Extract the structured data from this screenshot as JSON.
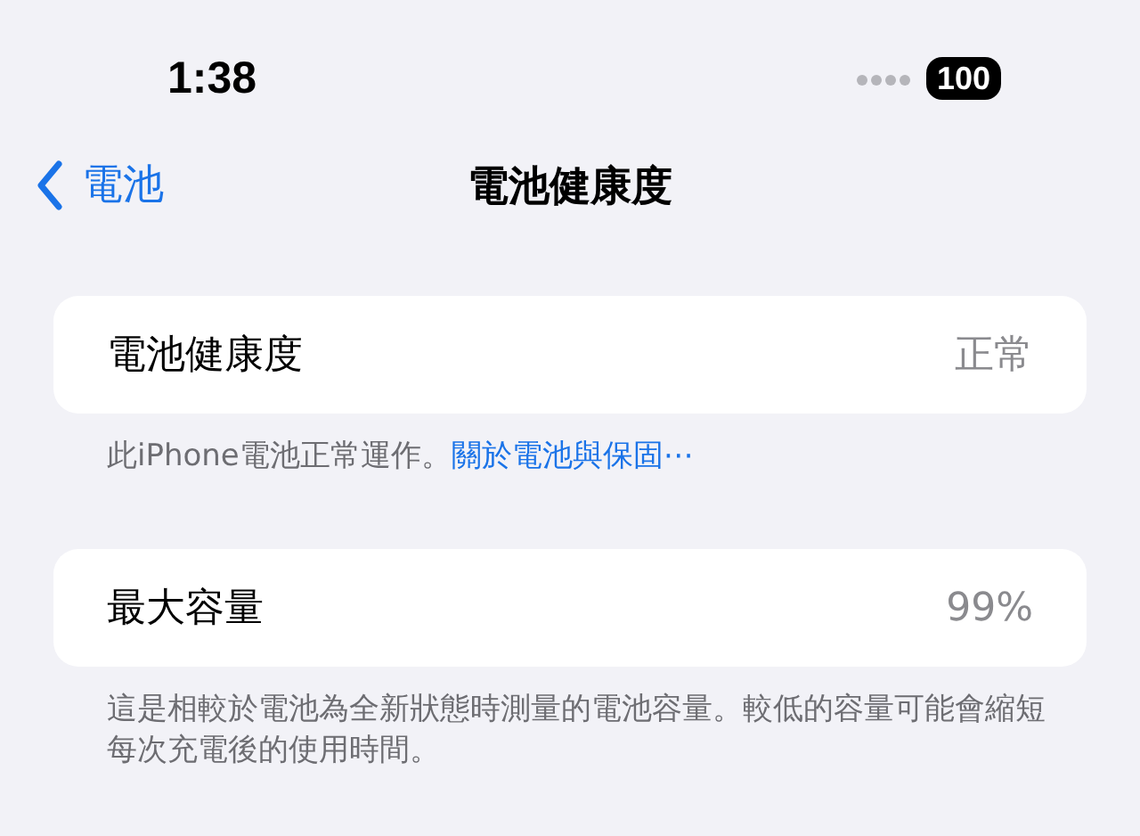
{
  "status_bar": {
    "time": "1:38",
    "battery": "100"
  },
  "nav": {
    "back": "電池",
    "title": "電池健康度"
  },
  "sections": [
    {
      "row": {
        "label": "電池健康度",
        "value": "正常"
      },
      "footer": "此iPhone電池正常運作。",
      "footer_link": "關於電池與保固⋯"
    },
    {
      "row": {
        "label": "最大容量",
        "value": "99%"
      },
      "footer": "這是相較於電池為全新狀態時測量的電池容量。較低的容量可能會縮短每次充電後的使用時間。"
    }
  ]
}
